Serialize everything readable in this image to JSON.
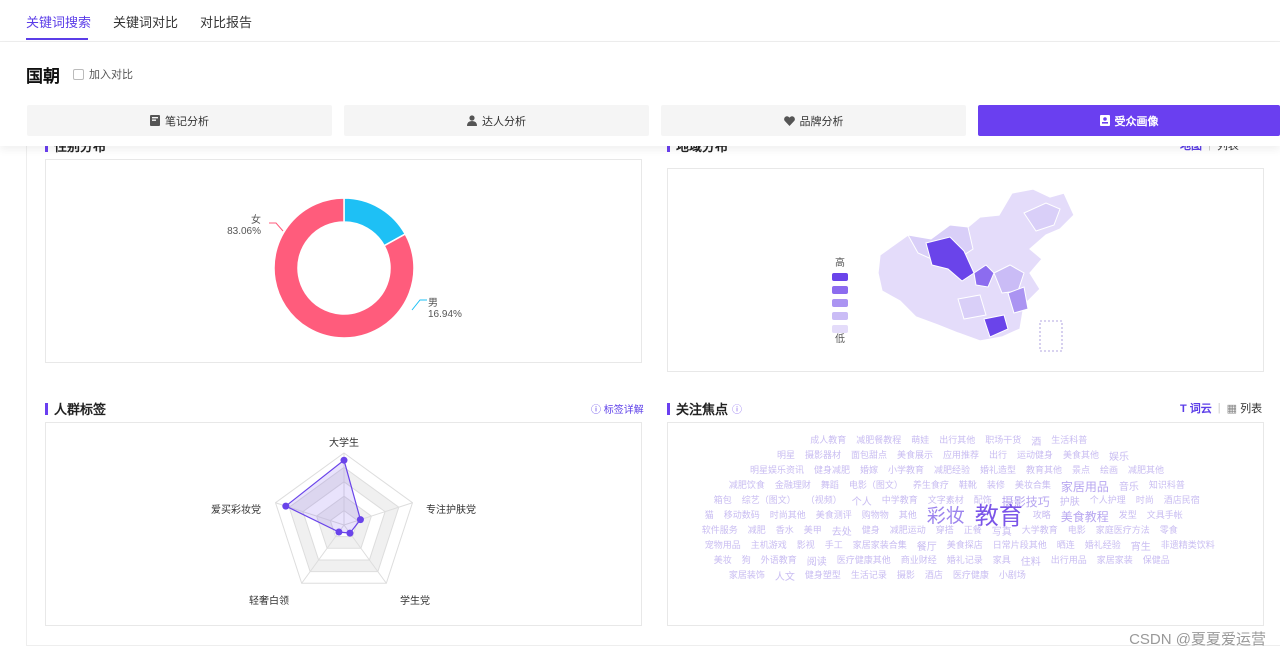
{
  "nav": {
    "tabs": [
      "关键词搜索",
      "关键词对比",
      "对比报告"
    ]
  },
  "header": {
    "keyword": "国朝",
    "compare_label": "加入对比",
    "buttons": [
      {
        "label": "笔记分析",
        "icon": "notebook-icon"
      },
      {
        "label": "达人分析",
        "icon": "user-icon"
      },
      {
        "label": "品牌分析",
        "icon": "heart-icon"
      },
      {
        "label": "受众画像",
        "icon": "profile-icon"
      }
    ]
  },
  "gender": {
    "title": "性别分布",
    "female_label": "女",
    "female_pct": "83.06%",
    "female_value": 83.06,
    "male_label": "男",
    "male_pct": "16.94%",
    "male_value": 16.94,
    "colors": {
      "female": "#ff5c7c",
      "male": "#1ec0f5"
    }
  },
  "region": {
    "title": "地域分布",
    "toggle_on": "地图",
    "toggle_off": "列表",
    "legend_high": "高",
    "legend_low": "低",
    "legend_colors": [
      "#6a44ea",
      "#8c6cef",
      "#ab94f2",
      "#cabcf6",
      "#e4dcfa"
    ]
  },
  "crowd": {
    "title": "人群标签",
    "link": "标签详解",
    "axes": [
      "大学生",
      "专注护肤党",
      "学生党",
      "轻奢白领",
      "爱买彩妆党"
    ],
    "values": [
      0.9,
      0.24,
      0.14,
      0.12,
      0.85
    ],
    "color": "#6a44ea"
  },
  "focus": {
    "title": "关注焦点",
    "toggle_on": "词云",
    "toggle_off": "列表",
    "words": [
      "成人教育",
      "减肥餐教程",
      "萌娃",
      "出行其他",
      "职场干货",
      "酒",
      "生活科普",
      "明星",
      "摄影器材",
      "面包甜点",
      "美食展示",
      "应用推荐",
      "出行",
      "运动健身",
      "美食其他",
      "娱乐",
      "明星娱乐资讯",
      "健身减肥",
      "婚嫁",
      "小学教育",
      "减肥经验",
      "婚礼造型",
      "教育其他",
      "景点",
      "绘画",
      "减肥其他",
      "减肥饮食",
      "金融理财",
      "舞蹈",
      "电影（图文）",
      "养生食疗",
      "鞋靴",
      "装修",
      "美妆合集",
      "家居用品",
      "音乐",
      "知识科普",
      "箱包",
      "综艺（图文）",
      "（视频）",
      "个人",
      "中学教育",
      "文字素材",
      "配饰",
      "摄影技巧",
      "护肤",
      "个人护理",
      "时尚",
      "酒店民宿",
      "猫",
      "移动数码",
      "时尚其他",
      "美食测评",
      "购物物",
      "其他",
      "彩妆",
      "教育",
      "攻略",
      "美食教程",
      "发型",
      "文具手帐",
      "软件服务",
      "减肥",
      "香水",
      "美甲",
      "去处",
      "健身",
      "减肥运动",
      "穿搭",
      "正餐",
      "写真",
      "大学教育",
      "电影",
      "家庭医疗方法",
      "零食",
      "宠物用品",
      "主机游戏",
      "影视",
      "手工",
      "家居家装合集",
      "餐厅",
      "美食探店",
      "日常片段其他",
      "晒连",
      "婚礼经验",
      "宵生",
      "非遗精类饮料",
      "美妆",
      "狗",
      "外语教育",
      "阅读",
      "医疗健康其他",
      "商业财经",
      "婚礼记录",
      "家具",
      "住料",
      "出行用品",
      "家居家装",
      "保健品",
      "家居装饰",
      "人文",
      "健身塑型",
      "生活记录",
      "摄影",
      "酒店",
      "医疗健康",
      "小剧场"
    ]
  },
  "watermark": "CSDN @夏夏爱运营"
}
